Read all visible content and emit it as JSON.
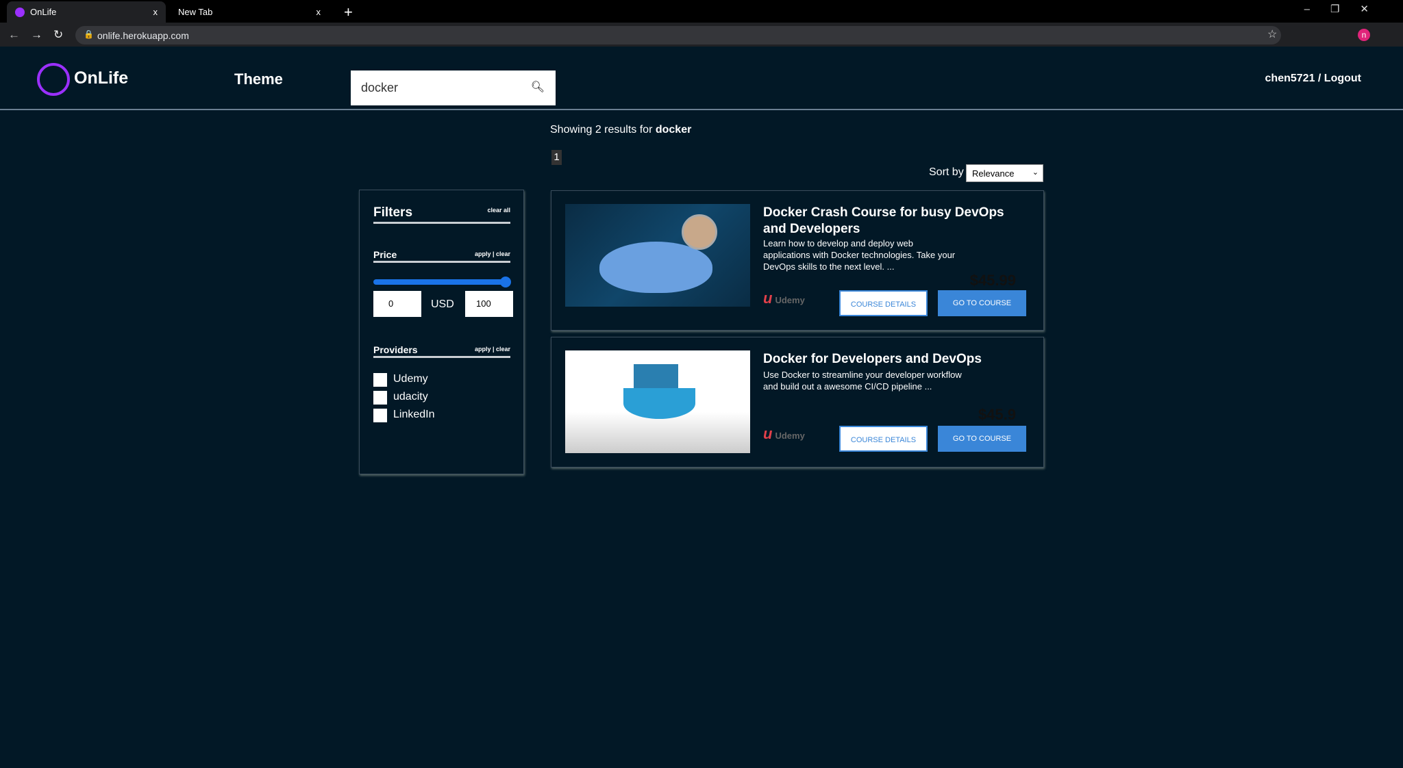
{
  "browser": {
    "tabs": [
      {
        "label": "OnLife",
        "close": "x"
      },
      {
        "label": "New Tab",
        "close": "x"
      }
    ],
    "new_tab": "+",
    "url": "onlife.herokuapp.com"
  },
  "header": {
    "brand": "OnLife",
    "theme": "Theme",
    "search_value": "docker",
    "user": "chen5721 / Logout"
  },
  "results": {
    "prefix": "Showing 2 results for ",
    "query": "docker",
    "page": "1",
    "sort_label": "Sort by",
    "sort_value": "Relevance"
  },
  "filters": {
    "title": "Filters",
    "clear_all": "clear all",
    "price": {
      "label": "Price",
      "actions": "apply | clear",
      "min": "0",
      "max": "100",
      "currency": "USD",
      "range_fraction": [
        0,
        1
      ]
    },
    "providers": {
      "label": "Providers",
      "actions": "apply | clear",
      "items": [
        "Udemy",
        "udacity",
        "LinkedIn"
      ]
    }
  },
  "courses": [
    {
      "title": "Docker Crash Course for busy DevOps and Developers",
      "description": "Learn how to develop and deploy web applications with Docker technologies. Take your DevOps skills to the next level. ...",
      "price": "$45.99",
      "provider": "Udemy",
      "details": "COURSE DETAILS",
      "go": "GO TO COURSE"
    },
    {
      "title": "Docker for Developers and DevOps",
      "description": "Use Docker to streamline your developer workflow and build out a awesome CI/CD pipeline ...",
      "price": "$45.9",
      "provider": "Udemy",
      "details": "COURSE DETAILS",
      "go": "GO TO COURSE"
    }
  ],
  "colors": {
    "background": "#021826",
    "accent": "#3a86d8",
    "brand": "#9b30ff",
    "udemy": "#e2404a"
  }
}
